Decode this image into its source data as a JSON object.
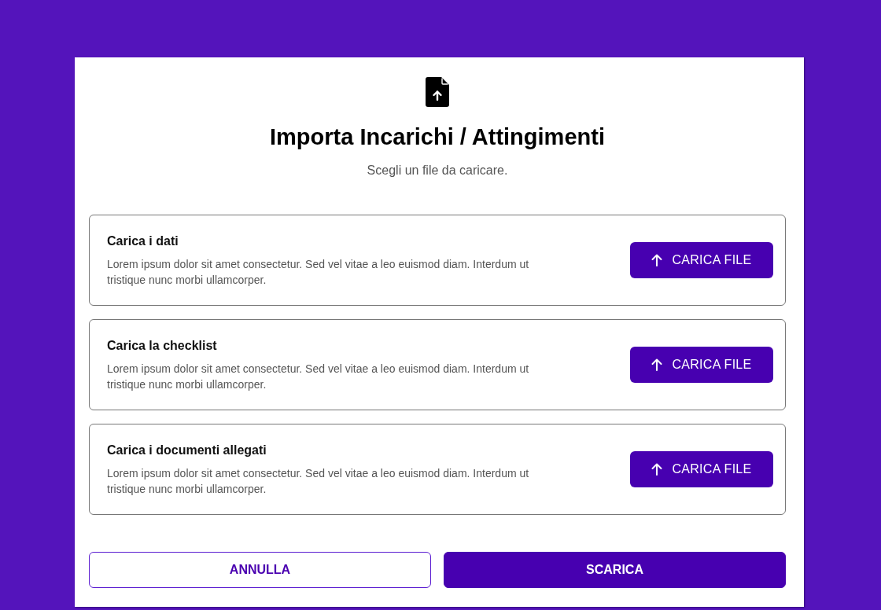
{
  "dialog": {
    "title": "Importa Incarichi / Attingimenti",
    "subtitle": "Scegli un file da caricare."
  },
  "upload_sections": [
    {
      "title": "Carica i dati",
      "description": "Lorem ipsum dolor sit amet consectetur. Sed vel vitae a leo euismod diam. Interdum ut tristique nunc morbi ullamcorper.",
      "button": "CARICA FILE"
    },
    {
      "title": "Carica la checklist",
      "description": "Lorem ipsum dolor sit amet consectetur. Sed vel vitae a leo euismod diam. Interdum ut tristique nunc morbi ullamcorper.",
      "button": "CARICA FILE"
    },
    {
      "title": "Carica i documenti allegati",
      "description": "Lorem ipsum dolor sit amet consectetur. Sed vel vitae a leo euismod diam. Interdum ut tristique nunc morbi ullamcorper.",
      "button": "CARICA FILE"
    }
  ],
  "footer_buttons": [
    {
      "label": "ANNULLA",
      "kind": "outlined"
    },
    {
      "label": "SCARICA",
      "kind": "filled"
    }
  ]
}
